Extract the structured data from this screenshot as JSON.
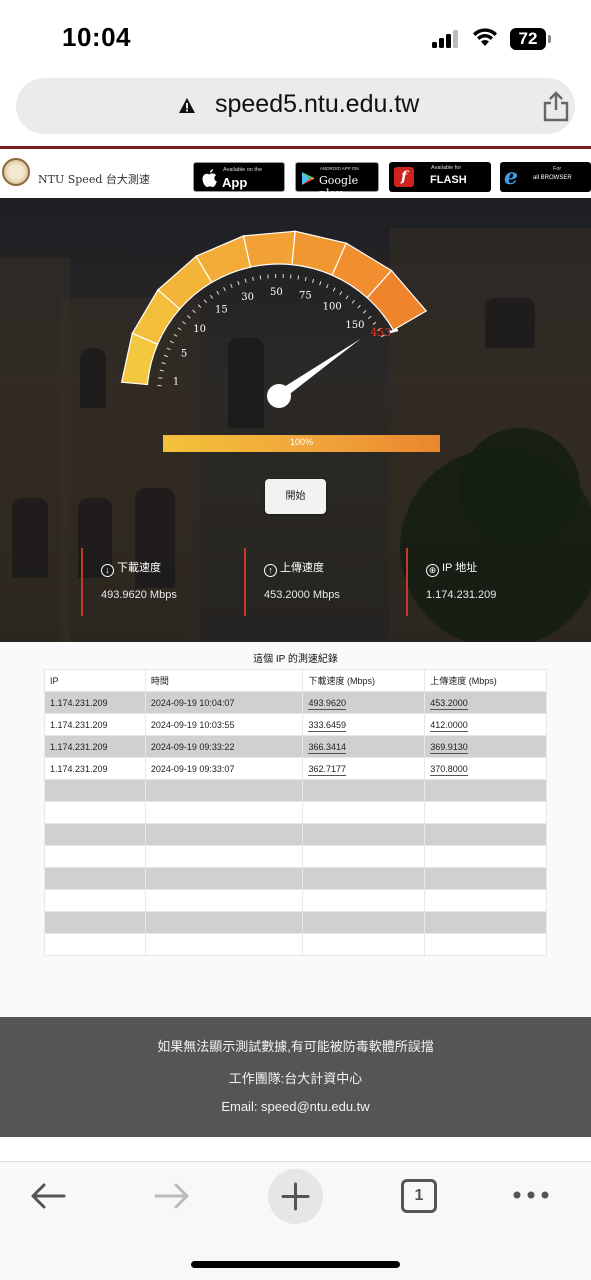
{
  "status_bar": {
    "time": "10:04",
    "battery": "72"
  },
  "browser": {
    "url": "speed5.ntu.edu.tw",
    "tab_count": "1"
  },
  "site": {
    "title": "NTU Speed 台大測速",
    "badges": {
      "appstore_small": "Available on the",
      "appstore_big": "App Store",
      "googleplay_small": "ANDROID APP ON",
      "googleplay_big": "Google play",
      "flash_small": "Available for",
      "flash_big": "FLASH",
      "browser_small": "For",
      "browser_big": "all BROWSER"
    }
  },
  "gauge": {
    "ticks": [
      "1",
      "5",
      "10",
      "15",
      "30",
      "50",
      "75",
      "100",
      "150"
    ],
    "current_value": "453",
    "progress_percent": 100,
    "progress_label": "100%",
    "start_button": "開始"
  },
  "stats": {
    "download_label": "下載速度",
    "download_value": "493.9620 Mbps",
    "upload_label": "上傳速度",
    "upload_value": "453.2000 Mbps",
    "ip_label": "IP 地址",
    "ip_value": "1.174.231.209"
  },
  "history": {
    "title": "這個 IP 的測速紀錄",
    "headers": [
      "IP",
      "時間",
      "下載速度 (Mbps)",
      "上傳速度 (Mbps)"
    ],
    "rows": [
      [
        "1.174.231.209",
        "2024-09-19 10:04:07",
        "493.9620",
        "453.2000"
      ],
      [
        "1.174.231.209",
        "2024-09-19 10:03:55",
        "333.6459",
        "412.0000"
      ],
      [
        "1.174.231.209",
        "2024-09-19 09:33:22",
        "366.3414",
        "369.9130"
      ],
      [
        "1.174.231.209",
        "2024-09-19 09:33:07",
        "362.7177",
        "370.8000"
      ]
    ]
  },
  "footer": {
    "notice": "如果無法顯示測試數據,有可能被防毒軟體所誤擋",
    "team": "工作團隊:台大計資中心",
    "email": "Email: speed@ntu.edu.tw"
  },
  "colors": {
    "accent_red": "#c23a2a",
    "gauge_yellow": "#f4c23a",
    "gauge_orange": "#f08a2e",
    "footer_bg": "#555555"
  }
}
